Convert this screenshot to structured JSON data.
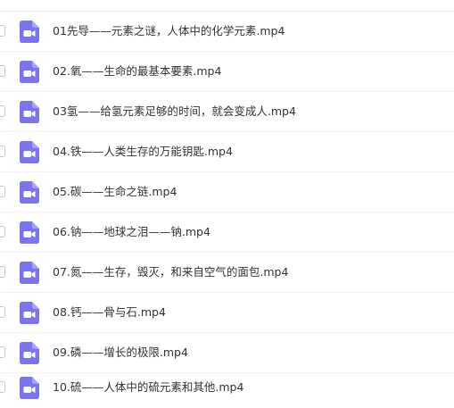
{
  "icon": {
    "name": "video-file-icon",
    "color": "#7b74ee",
    "symbol_color": "#ffffff"
  },
  "files": [
    {
      "name": "01先导——元素之谜，人体中的化学元素.mp4"
    },
    {
      "name": "02.氧——生命的最基本要素.mp4"
    },
    {
      "name": "03氢——给氢元素足够的时间，就会变成人.mp4"
    },
    {
      "name": "04.铁——人类生存的万能钥匙.mp4"
    },
    {
      "name": "05.碳——生命之链.mp4"
    },
    {
      "name": "06.钠——地球之泪——钠.mp4"
    },
    {
      "name": "07.氮——生存，毁灭，和来自空气的面包.mp4"
    },
    {
      "name": "08.钙——骨与石.mp4"
    },
    {
      "name": "09.磷——增长的极限.mp4"
    },
    {
      "name": "10.硫——人体中的硫元素和其他.mp4"
    }
  ]
}
